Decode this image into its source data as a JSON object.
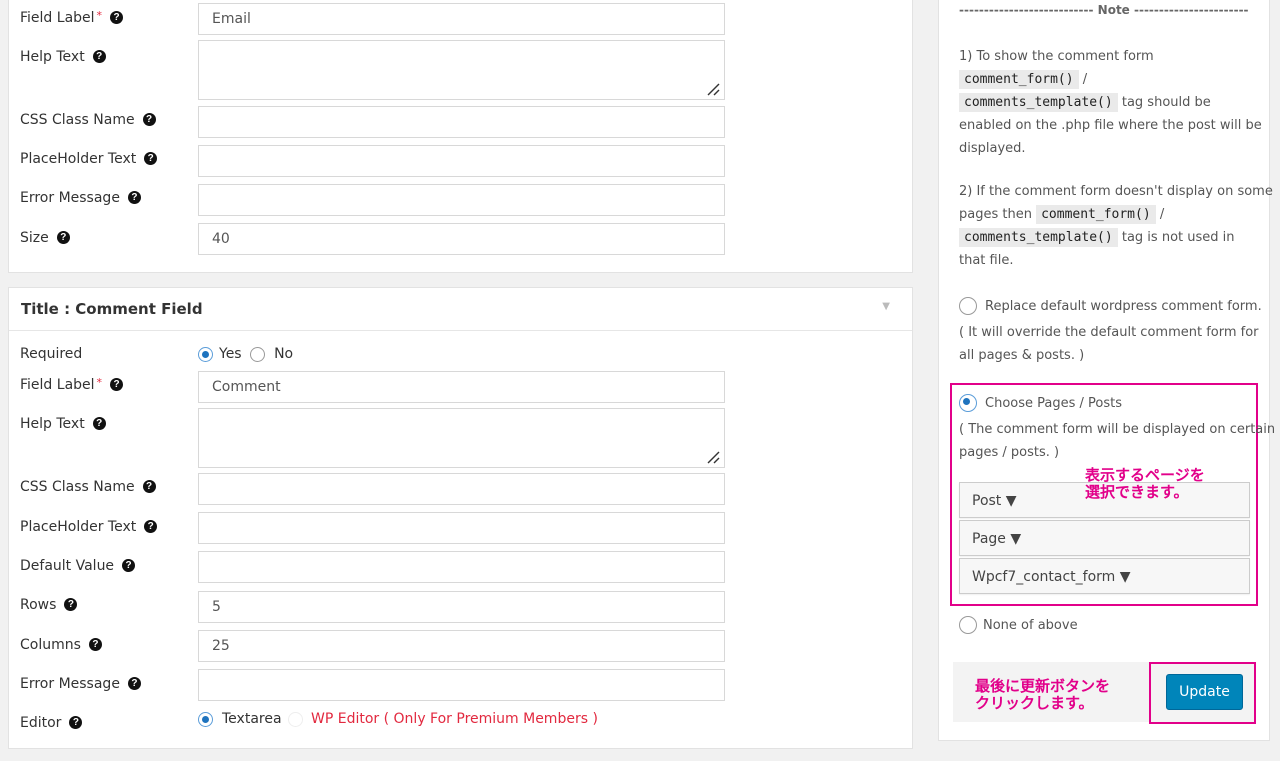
{
  "field1": {
    "field_label": "Field Label",
    "required_mark": "*",
    "help_text": "Help Text",
    "css_class": "CSS Class Name",
    "placeholder": "PlaceHolder Text",
    "error_message": "Error Message",
    "size_label": "Size",
    "label_value": "Email",
    "size_value": "40"
  },
  "field2": {
    "title": "Title : Comment Field",
    "toggle_icon": "▼",
    "required": "Required",
    "yes": "Yes",
    "no": "No",
    "field_label": "Field Label",
    "required_mark": "*",
    "help_text": "Help Text",
    "css_class": "CSS Class Name",
    "placeholder": "PlaceHolder Text",
    "default_value": "Default Value",
    "rows": "Rows",
    "columns": "Columns",
    "error_message": "Error Message",
    "editor": "Editor",
    "label_value": "Comment",
    "rows_value": "5",
    "columns_value": "25",
    "editor_textarea": "Textarea",
    "editor_wp": "WP Editor ( Only For Premium Members )"
  },
  "sidebar": {
    "note_header": "--------------------------- Note ---------------------------",
    "note1_text1": "1) To show the comment form",
    "note1_code1": "comment_form()",
    "slash": "/",
    "note1_code2": "comments_template()",
    "note1_text2": "tag should be",
    "note1_text3": "enabled on the .php file where the post will be",
    "note1_text4": "displayed.",
    "note2_text1": "2) If the comment form doesn't display on some",
    "note2_text2": "pages then",
    "note2_code1": "comment_form()",
    "note2_code2": "comments_template()",
    "note2_text3": "tag is not used in",
    "note2_text4": "that file.",
    "opt_replace": "Replace default wordpress comment form.",
    "opt_replace_desc1": "( It will override the default comment form for",
    "opt_replace_desc2": "all pages & posts. )",
    "opt_choose": "Choose Pages / Posts",
    "opt_choose_desc1": "( The comment form will be displayed on certain",
    "opt_choose_desc2": "pages / posts. )",
    "btn_post": "Post ▼",
    "btn_page": "Page ▼",
    "btn_cf7": "Wpcf7_contact_form ▼",
    "opt_none": "None of above",
    "update": "Update"
  },
  "annotations": {
    "select_line1": "表示するページを",
    "select_line2": "選択できます。",
    "update_line1": "最後に更新ボタンを",
    "update_line2": "クリックします。"
  },
  "colors": {
    "accent": "#e2008a",
    "button": "#0085ba",
    "required": "#e2293f"
  }
}
